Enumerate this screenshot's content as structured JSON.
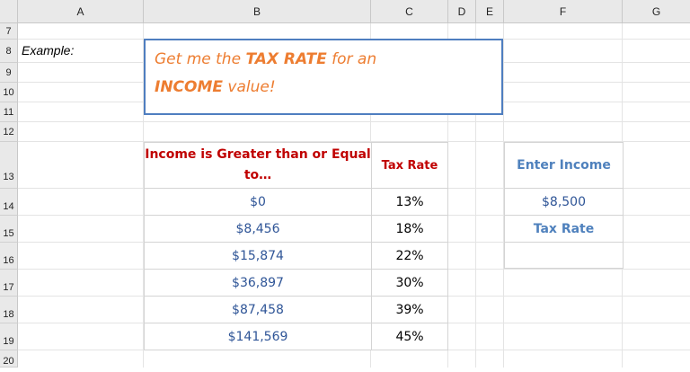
{
  "columns": [
    "A",
    "B",
    "C",
    "D",
    "E",
    "F",
    "G"
  ],
  "rows": [
    "7",
    "8",
    "9",
    "10",
    "11",
    "12",
    "13",
    "14",
    "15",
    "16",
    "17",
    "18",
    "19",
    "20"
  ],
  "example_label": "Example:",
  "callout": {
    "line1_pre": "Get me the ",
    "line1_bold": "TAX RATE",
    "line1_post": " for an",
    "line2_bold": "INCOME",
    "line2_post": " value!"
  },
  "table": {
    "headers": [
      "Income is Greater than or Equal to…",
      "Tax Rate"
    ],
    "rows": [
      {
        "income": "$0",
        "rate": "13%"
      },
      {
        "income": "$8,456",
        "rate": "18%"
      },
      {
        "income": "$15,874",
        "rate": "22%"
      },
      {
        "income": "$36,897",
        "rate": "30%"
      },
      {
        "income": "$87,458",
        "rate": "39%"
      },
      {
        "income": "$141,569",
        "rate": "45%"
      }
    ]
  },
  "lookup": {
    "enter_income_label": "Enter Income",
    "income_value": "$8,500",
    "tax_rate_label": "Tax Rate",
    "tax_rate_value": ""
  }
}
